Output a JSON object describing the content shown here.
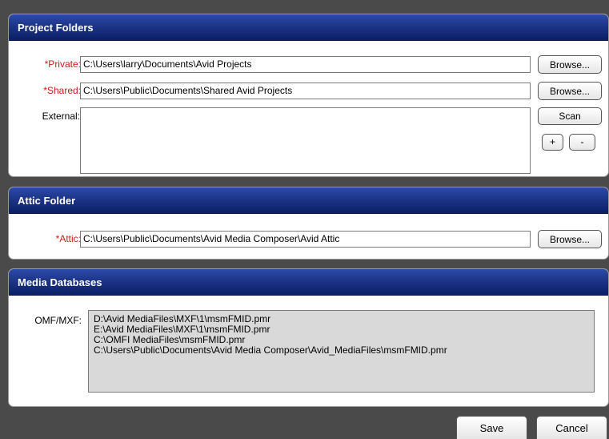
{
  "project_folders": {
    "title": "Project Folders",
    "private_label": "*Private:",
    "private_value": "C:\\Users\\larry\\Documents\\Avid Projects",
    "shared_label": "*Shared:",
    "shared_value": "C:\\Users\\Public\\Documents\\Shared Avid Projects",
    "external_label": "External:",
    "browse_label": "Browse...",
    "scan_label": "Scan",
    "add_label": "+",
    "remove_label": "-"
  },
  "attic_folder": {
    "title": "Attic Folder",
    "attic_label": "*Attic:",
    "attic_value": "C:\\Users\\Public\\Documents\\Avid Media Composer\\Avid Attic",
    "browse_label": "Browse..."
  },
  "media_databases": {
    "title": "Media Databases",
    "omf_label": "OMF/MXF:",
    "entries": [
      "D:\\Avid MediaFiles\\MXF\\1\\msmFMID.pmr",
      "E:\\Avid MediaFiles\\MXF\\1\\msmFMID.pmr",
      "C:\\OMFI MediaFiles\\msmFMID.pmr",
      "C:\\Users\\Public\\Documents\\Avid Media Composer\\Avid_MediaFiles\\msmFMID.pmr"
    ]
  },
  "footer": {
    "save_label": "Save",
    "cancel_label": "Cancel"
  }
}
